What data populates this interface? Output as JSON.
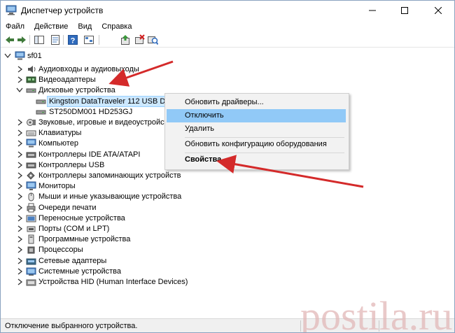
{
  "window": {
    "title": "Диспетчер устройств",
    "title_icon": "device-manager-icon"
  },
  "menu": [
    "Файл",
    "Действие",
    "Вид",
    "Справка"
  ],
  "toolbar": [
    "back-icon",
    "forward-icon",
    "show-hide-console-tree-icon",
    "properties-icon",
    "help-icon",
    "console-tree-icon",
    "update-driver-icon",
    "uninstall-icon",
    "scan-hardware-icon"
  ],
  "tree": {
    "root": "sf01",
    "categories": [
      {
        "label": "Аудиовходы и аудиовыходы",
        "icon": "audio-io-icon",
        "expanded": false
      },
      {
        "label": "Видеоадаптеры",
        "icon": "display-adapter-icon",
        "expanded": false
      },
      {
        "label": "Дисковые устройства",
        "icon": "disk-drive-icon",
        "expanded": true,
        "children": [
          {
            "label": "Kingston DataTraveler 112 USB Device",
            "selected": true
          },
          {
            "label": "ST250DM001 HD253GJ",
            "selected": false
          }
        ]
      },
      {
        "label": "Звуковые, игровые и видеоустройства",
        "icon": "sound-icon",
        "expanded": false
      },
      {
        "label": "Клавиатуры",
        "icon": "keyboard-icon",
        "expanded": false
      },
      {
        "label": "Компьютер",
        "icon": "computer-icon",
        "expanded": false
      },
      {
        "label": "Контроллеры IDE ATA/ATAPI",
        "icon": "ide-controller-icon",
        "expanded": false
      },
      {
        "label": "Контроллеры USB",
        "icon": "usb-controller-icon",
        "expanded": false
      },
      {
        "label": "Контроллеры запоминающих устройств",
        "icon": "storage-controller-icon",
        "expanded": false
      },
      {
        "label": "Мониторы",
        "icon": "monitor-icon",
        "expanded": false
      },
      {
        "label": "Мыши и иные указывающие устройства",
        "icon": "mouse-icon",
        "expanded": false
      },
      {
        "label": "Очереди печати",
        "icon": "print-queue-icon",
        "expanded": false
      },
      {
        "label": "Переносные устройства",
        "icon": "portable-device-icon",
        "expanded": false
      },
      {
        "label": "Порты (COM и LPT)",
        "icon": "port-icon",
        "expanded": false
      },
      {
        "label": "Программные устройства",
        "icon": "software-device-icon",
        "expanded": false
      },
      {
        "label": "Процессоры",
        "icon": "processor-icon",
        "expanded": false
      },
      {
        "label": "Сетевые адаптеры",
        "icon": "network-adapter-icon",
        "expanded": false
      },
      {
        "label": "Системные устройства",
        "icon": "system-device-icon",
        "expanded": false
      },
      {
        "label": "Устройства HID (Human Interface Devices)",
        "icon": "hid-icon",
        "expanded": false
      }
    ]
  },
  "context_menu": {
    "update_driver": "Обновить драйверы...",
    "disable": "Отключить",
    "uninstall": "Удалить",
    "scan": "Обновить конфигурацию оборудования",
    "properties": "Свойства"
  },
  "status": {
    "text": "Отключение выбранного устройства."
  },
  "watermark": "postila.ru",
  "colors": {
    "arrow": "#d42a2a",
    "highlight": "#91c9f7",
    "selection": "#cce8ff"
  }
}
